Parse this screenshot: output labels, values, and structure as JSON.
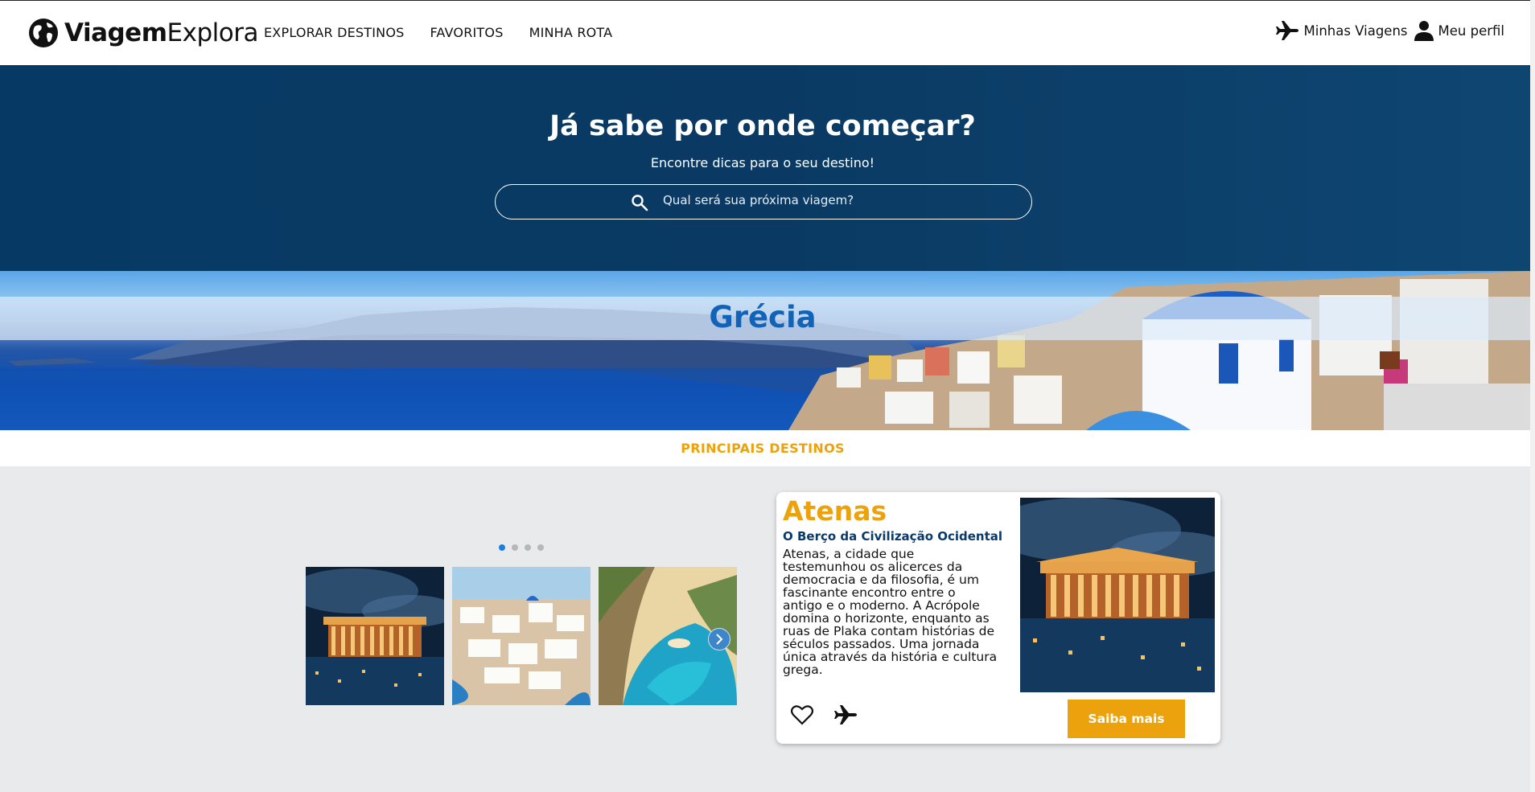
{
  "header": {
    "logo_bold": "Viagem",
    "logo_light": "Explora",
    "nav": [
      "EXPLORAR DESTINOS",
      "FAVORITOS",
      "MINHA ROTA"
    ],
    "my_trips": "Minhas Viagens",
    "profile": "Meu perfil"
  },
  "hero": {
    "title": "Já sabe por onde começar?",
    "subtitle": "Encontre dicas para o seu destino!",
    "search_placeholder": "Qual será sua próxima viagem?"
  },
  "banner": {
    "country": "Grécia"
  },
  "section": {
    "label": "PRINCIPAIS DESTINOS"
  },
  "carousel": {
    "dots": 4,
    "active_dot": 0,
    "thumbs": [
      "athens-parthenon-image",
      "santorini-village-image",
      "navagio-beach-image"
    ]
  },
  "card": {
    "title": "Atenas",
    "subtitle": "O Berço da Civilização Ocidental",
    "description": "Atenas, a cidade que testemunhou os alicerces da democracia e da filosofia, é um fascinante encontro entre o antigo e o moderno. A Acrópole domina o horizonte, enquanto as ruas de Plaka contam histórias de séculos passados. Uma jornada única através da história e cultura grega.",
    "button": "Saiba mais"
  },
  "colors": {
    "navy": "#063a64",
    "accent": "#eba20c",
    "title_blue": "#1263b8",
    "dot_active": "#1c7fe0"
  }
}
